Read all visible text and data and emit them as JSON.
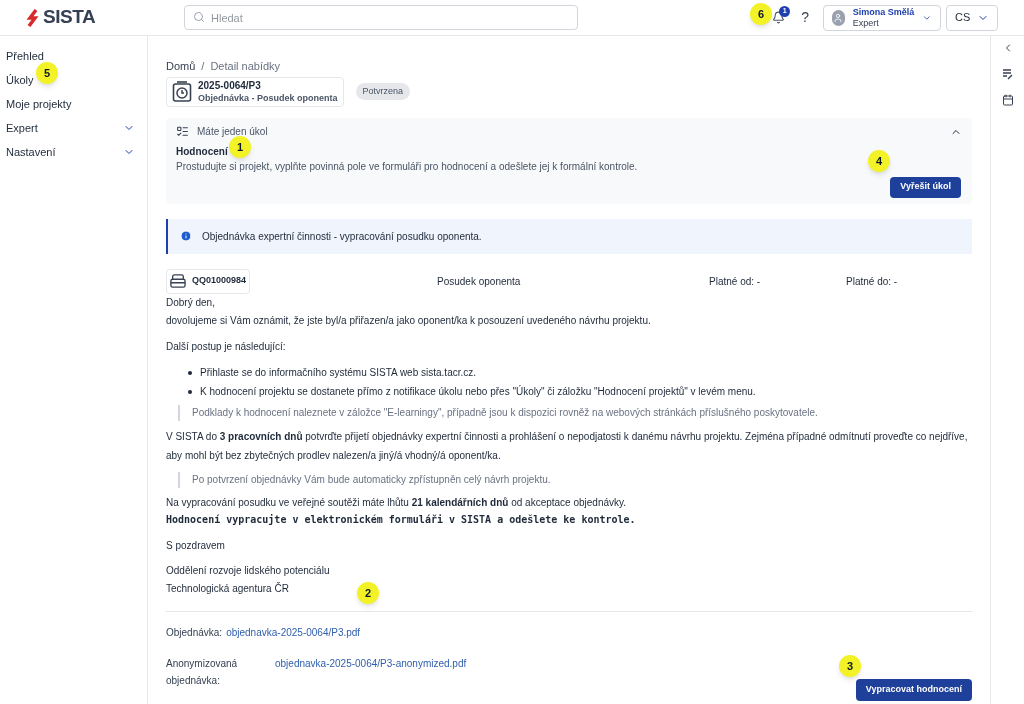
{
  "header": {
    "logo": "SISTA",
    "search": {
      "placeholder": "Hledat"
    },
    "notifications": "1",
    "help": "?",
    "user": {
      "name": "Simona Smělá",
      "role": "Expert"
    },
    "language": "CS"
  },
  "sidebar": {
    "items": [
      {
        "label": "Přehled",
        "expandable": false
      },
      {
        "label": "Úkoly",
        "expandable": false
      },
      {
        "label": "Moje projekty",
        "expandable": false
      },
      {
        "label": "Expert",
        "expandable": true
      },
      {
        "label": "Nastavení",
        "expandable": true
      }
    ]
  },
  "breadcrumb": {
    "items": [
      "Domů",
      "Detail nabídky"
    ],
    "separator": "/"
  },
  "document": {
    "number": "2025-0064/P3",
    "type": "Objednávka - Posudek oponenta",
    "status": "Potvrzena"
  },
  "task_panel": {
    "heading": "Máte jeden úkol",
    "expanded": true,
    "title": "Hodnocení",
    "description": "Prostudujte si projekt, vyplňte povinná pole ve formuláři pro hodnocení a odešlete jej k formální kontrole.",
    "button": "Vyřešit úkol"
  },
  "info_banner": "Objednávka expertní činnosti - vypracování posudku oponenta.",
  "letter": {
    "code": "QQ01000984",
    "kind": "Posudek oponenta",
    "valid_from": "Platné od: -",
    "valid_to": "Platné do: -",
    "blocks": [
      {
        "kind": "line",
        "text": "Dobrý den,"
      },
      {
        "kind": "para",
        "text": "dovolujeme si Vám oznámit, že jste byl/a přiřazen/a jako oponent/ka k posouzení uvedeného návrhu projektu."
      },
      {
        "kind": "para",
        "text": "Další postup je následující:"
      },
      {
        "kind": "bullets",
        "items": [
          "Přihlaste se do informačního systému SISTA web sista.tacr.cz.",
          "K hodnocení projektu se dostanete přímo z notifikace úkolu nebo přes \"Úkoly\" či záložku \"Hodnocení projektů\" v levém menu."
        ]
      },
      {
        "kind": "quote",
        "text": "Podklady k hodnocení naleznete v záložce \"E-learningy\", případně jsou k dispozici rovněž na webových stránkách příslušného poskytovatele."
      },
      {
        "kind": "para",
        "text": "V SISTA do **3 pracovních dnů** potvrďte přijetí objednávky expertní činnosti a prohlášení o nepodjatosti k danému návrhu projektu. Zejména případné odmítnutí proveďte co nejdříve, aby mohl být bez zbytečných prodlev nalezen/a jiný/á vhodný/á oponent/ka."
      },
      {
        "kind": "quote",
        "text": "Po potvrzení objednávky Vám bude automaticky zpřístupněn celý návrh projektu."
      },
      {
        "kind": "line",
        "text": "Na vypracování posudku ve veřejné soutěži máte lhůtu **21 kalendářních dnů** od akceptace objednávky."
      },
      {
        "kind": "code",
        "text": "Hodnocení vypracujte v elektronickém formuláři v SISTA a odešlete ke kontrole."
      },
      {
        "kind": "para",
        "text": "S pozdravem"
      },
      {
        "kind": "line",
        "text": "Oddělení rozvoje lidského potenciálu"
      },
      {
        "kind": "para",
        "text": "Technologická agentura ČR"
      }
    ]
  },
  "attachments": [
    {
      "label": "Objednávka:",
      "file": "objednavka-2025-0064/P3.pdf"
    },
    {
      "label": "Anonymizovaná objednávka:",
      "file": "objednavka-2025-0064/P3-anonymized.pdf"
    }
  ],
  "primary_button": "Vypracovat hodnocení",
  "callouts": [
    "6",
    "5",
    "1",
    "4",
    "2",
    "3"
  ]
}
